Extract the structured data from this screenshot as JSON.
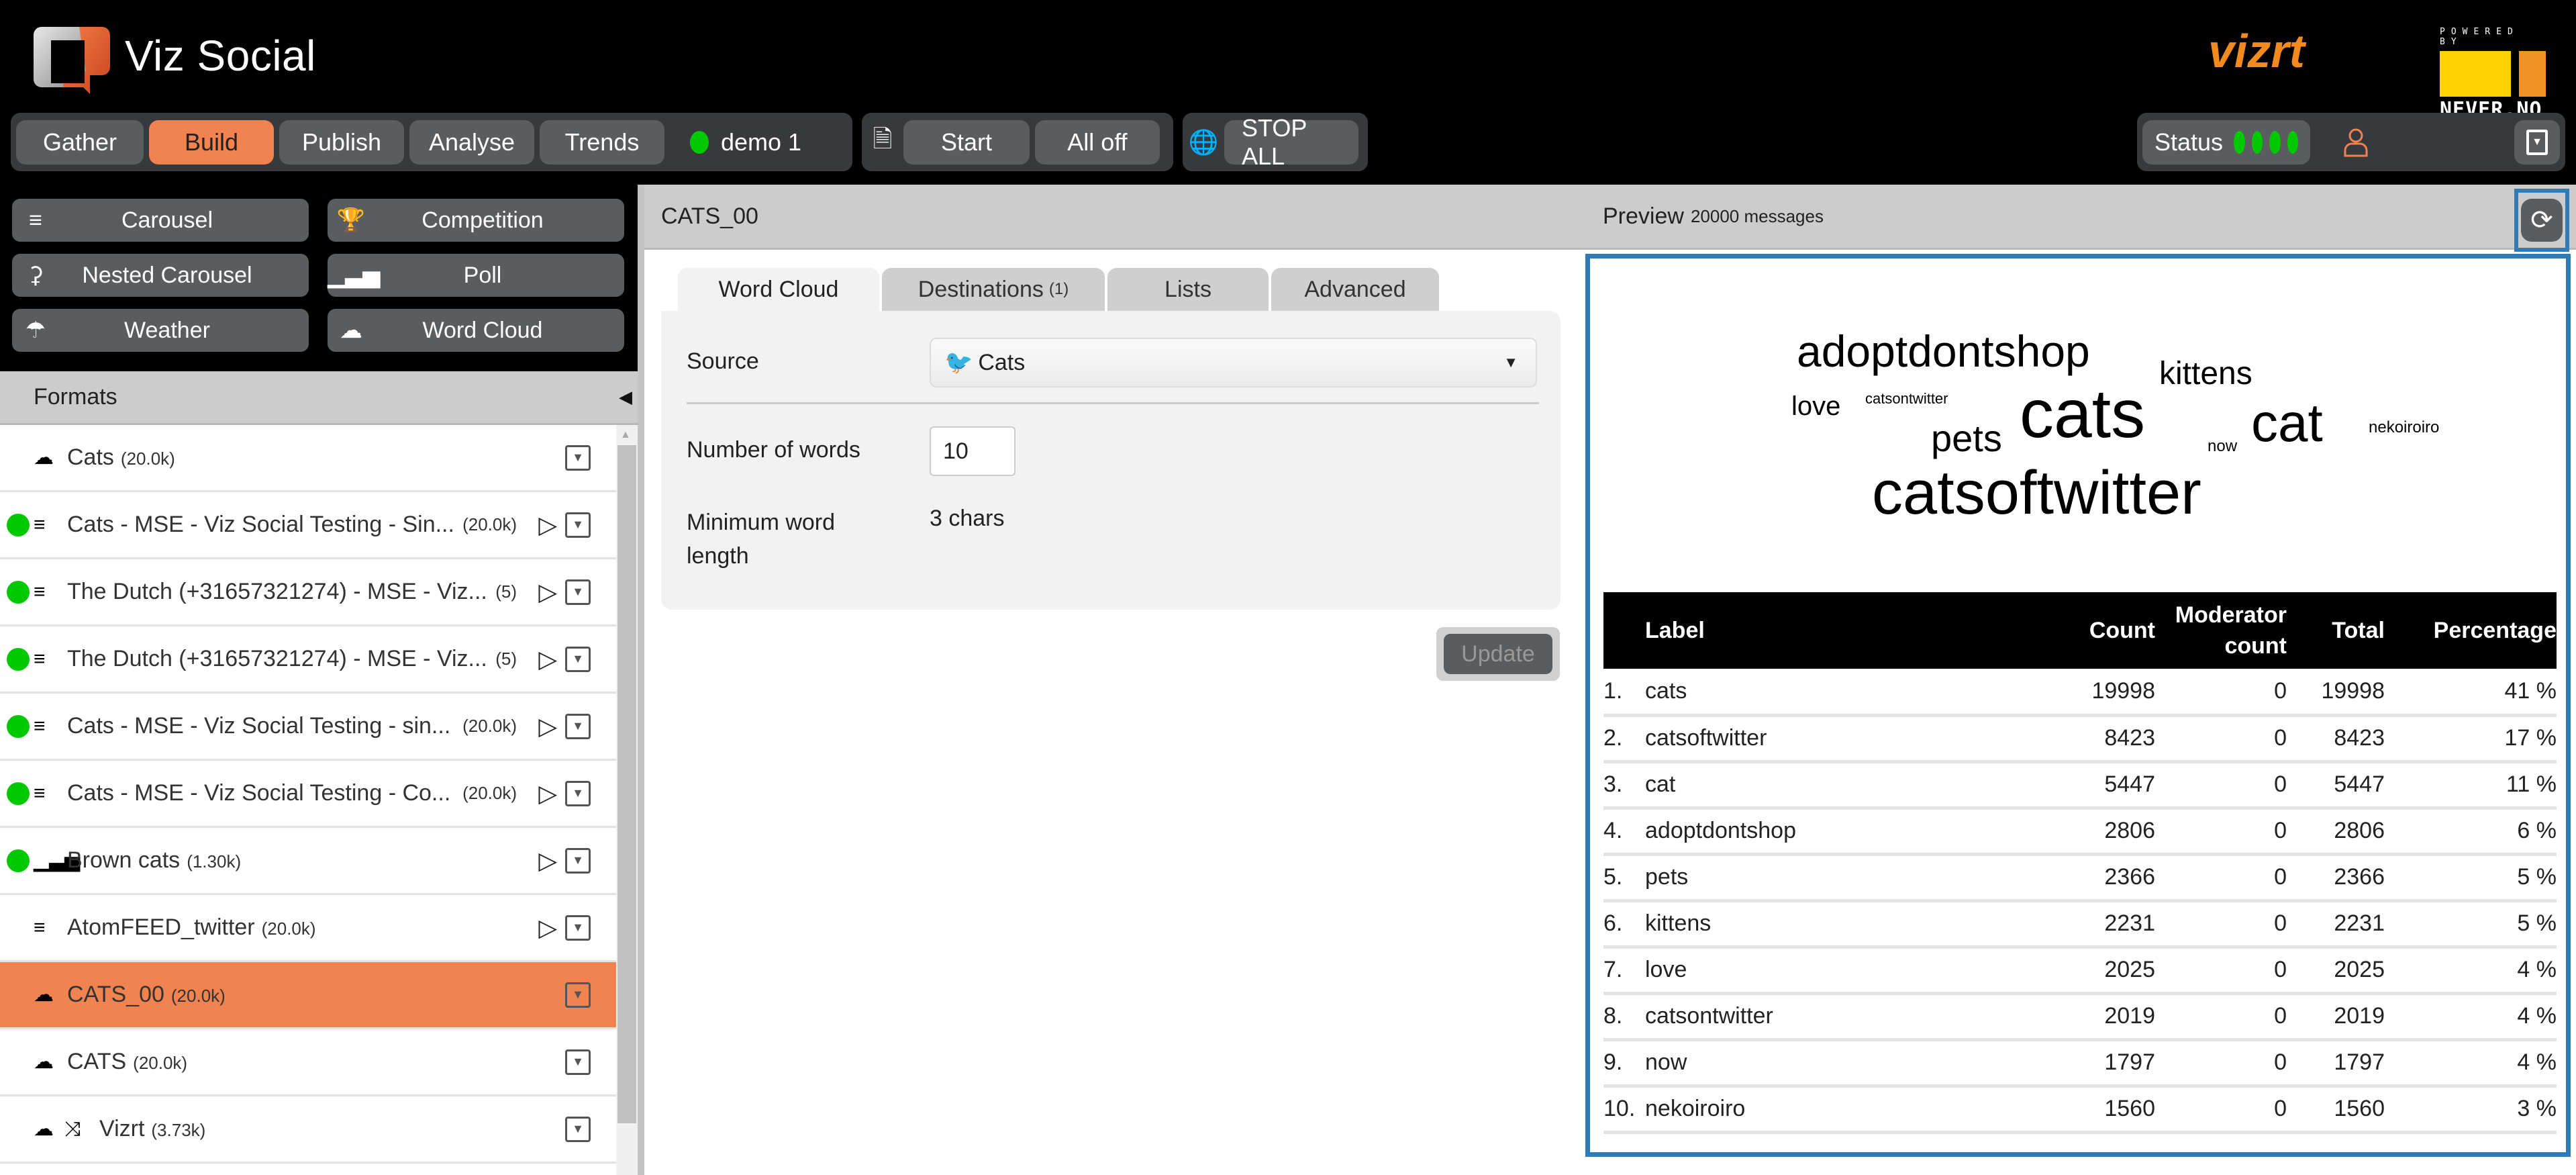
{
  "app": {
    "title": "Viz Social",
    "partner_logo": "vizrt",
    "powered_by": "POWERED BY",
    "powered_brand": "NEVER.NO"
  },
  "nav": {
    "tabs": [
      {
        "label": "Gather",
        "active": false
      },
      {
        "label": "Build",
        "active": true
      },
      {
        "label": "Publish",
        "active": false
      },
      {
        "label": "Analyse",
        "active": false
      },
      {
        "label": "Trends",
        "active": false
      }
    ],
    "profile": {
      "label": "demo 1",
      "status_color": "#00c800"
    },
    "playout": {
      "icon": "book-icon",
      "start_label": "Start",
      "alloff_label": "All off"
    },
    "global": {
      "icon": "globe-icon",
      "stop_label": "STOP ALL"
    },
    "status": {
      "label": "Status",
      "indicators": [
        "#00c800",
        "#00c800",
        "#00c800",
        "#00c800"
      ]
    },
    "user_icon": "user-icon",
    "menu_icon": "dropdown-icon"
  },
  "templates": [
    {
      "label": "Carousel",
      "icon": "list-icon"
    },
    {
      "label": "Competition",
      "icon": "trophy-icon"
    },
    {
      "label": "Nested Carousel",
      "icon": "share-icon"
    },
    {
      "label": "Poll",
      "icon": "bar-chart-icon"
    },
    {
      "label": "Weather",
      "icon": "umbrella-icon"
    },
    {
      "label": "Word Cloud",
      "icon": "cloud-icon"
    }
  ],
  "formats": {
    "title": "Formats",
    "items": [
      {
        "name": "Cats",
        "count": "(20.0k)",
        "icon": "cloud-icon",
        "live": false,
        "playable": false,
        "selected": false
      },
      {
        "name": "Cats - MSE - Viz Social Testing - Sin...",
        "count": "(20.0k)",
        "icon": "list-icon",
        "live": true,
        "playable": true,
        "selected": false
      },
      {
        "name": "The Dutch (+31657321274) - MSE - Viz...",
        "count": "(5)",
        "icon": "list-icon",
        "live": true,
        "playable": true,
        "selected": false
      },
      {
        "name": "The Dutch (+31657321274) - MSE - Viz...",
        "count": "(5)",
        "icon": "list-icon",
        "live": true,
        "playable": true,
        "selected": false
      },
      {
        "name": "Cats - MSE - Viz Social Testing - sin...",
        "count": "(20.0k)",
        "icon": "list-icon",
        "live": true,
        "playable": true,
        "selected": false
      },
      {
        "name": "Cats - MSE - Viz Social Testing - Co...",
        "count": "(20.0k)",
        "icon": "list-icon",
        "live": true,
        "playable": true,
        "selected": false
      },
      {
        "name": "Brown cats",
        "count": "(1.30k)",
        "icon": "bar-chart-icon",
        "live": true,
        "playable": true,
        "selected": false
      },
      {
        "name": "AtomFEED_twitter",
        "count": "(20.0k)",
        "icon": "list-icon",
        "live": false,
        "playable": true,
        "selected": false
      },
      {
        "name": "CATS_00",
        "count": "(20.0k)",
        "icon": "cloud-icon",
        "live": false,
        "playable": false,
        "selected": true
      },
      {
        "name": "CATS",
        "count": "(20.0k)",
        "icon": "cloud-icon",
        "live": false,
        "playable": false,
        "selected": false
      },
      {
        "name": "Vizrt",
        "count": "(3.73k)",
        "icon": "cloud-icon",
        "icon2": "shuffle-icon",
        "live": false,
        "playable": false,
        "selected": false
      }
    ]
  },
  "editor": {
    "title": "CATS_00",
    "tabs": [
      {
        "label": "Word Cloud",
        "badge": "",
        "active": true
      },
      {
        "label": "Destinations",
        "badge": "(1)",
        "active": false
      },
      {
        "label": "Lists",
        "badge": "",
        "active": false
      },
      {
        "label": "Advanced",
        "badge": "",
        "active": false
      }
    ],
    "source_label": "Source",
    "source_value": "Cats",
    "source_icon": "twitter-icon",
    "num_words_label": "Number of words",
    "num_words_value": "10",
    "min_len_label": "Minimum word length",
    "min_len_value": "3 chars",
    "update_label": "Update"
  },
  "preview": {
    "title": "Preview",
    "messages": "20000 messages",
    "refresh_icon": "refresh-icon",
    "columns": [
      "",
      "Label",
      "Count",
      "Moderator count",
      "Total",
      "Percentage"
    ],
    "rows": [
      {
        "rank": "1.",
        "label": "cats",
        "count": "19998",
        "mod": "0",
        "total": "19998",
        "pct": "41 %"
      },
      {
        "rank": "2.",
        "label": "catsoftwitter",
        "count": "8423",
        "mod": "0",
        "total": "8423",
        "pct": "17 %"
      },
      {
        "rank": "3.",
        "label": "cat",
        "count": "5447",
        "mod": "0",
        "total": "5447",
        "pct": "11 %"
      },
      {
        "rank": "4.",
        "label": "adoptdontshop",
        "count": "2806",
        "mod": "0",
        "total": "2806",
        "pct": "6 %"
      },
      {
        "rank": "5.",
        "label": "pets",
        "count": "2366",
        "mod": "0",
        "total": "2366",
        "pct": "5 %"
      },
      {
        "rank": "6.",
        "label": "kittens",
        "count": "2231",
        "mod": "0",
        "total": "2231",
        "pct": "5 %"
      },
      {
        "rank": "7.",
        "label": "love",
        "count": "2025",
        "mod": "0",
        "total": "2025",
        "pct": "4 %"
      },
      {
        "rank": "8.",
        "label": "catsontwitter",
        "count": "2019",
        "mod": "0",
        "total": "2019",
        "pct": "4 %"
      },
      {
        "rank": "9.",
        "label": "now",
        "count": "1797",
        "mod": "0",
        "total": "1797",
        "pct": "4 %"
      },
      {
        "rank": "10.",
        "label": "nekoiroiro",
        "count": "1560",
        "mod": "0",
        "total": "1560",
        "pct": "3 %"
      }
    ],
    "cloud_words": [
      "adoptdontshop",
      "kittens",
      "love",
      "catsontwitter",
      "pets",
      "cats",
      "now",
      "cat",
      "nekoiroiro",
      "catsoftwitter"
    ]
  }
}
